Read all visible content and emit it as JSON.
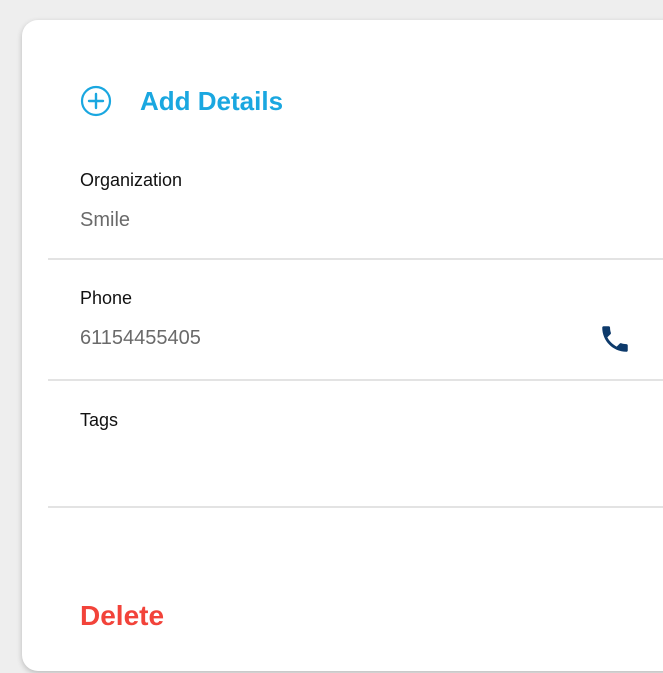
{
  "add_details": {
    "icon": "plus-circle-icon",
    "label": "Add Details",
    "color": "#1aa7e0"
  },
  "fields": {
    "organization": {
      "label": "Organization",
      "value": "Smile"
    },
    "phone": {
      "label": "Phone",
      "value": "61154455405",
      "action_icon": "phone-icon"
    },
    "tags": {
      "label": "Tags",
      "value": ""
    }
  },
  "delete": {
    "label": "Delete",
    "color": "#f2433a"
  }
}
